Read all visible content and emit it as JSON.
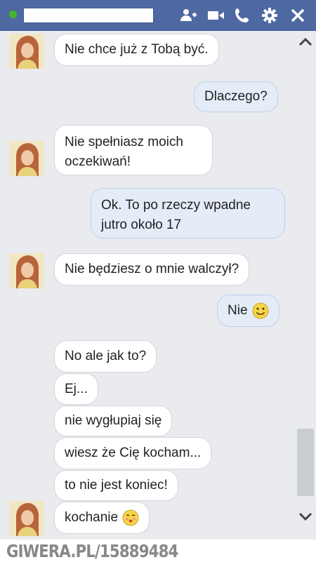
{
  "header": {
    "contact_name": "",
    "status": "online",
    "icons": [
      "add-friend-icon",
      "video-call-icon",
      "voice-call-icon",
      "settings-icon",
      "close-icon"
    ],
    "background_color": "#4e69a2"
  },
  "messages": [
    {
      "from": "them",
      "text": "Nie chce już z Tobą być."
    },
    {
      "from": "me",
      "text": "Dlaczego?"
    },
    {
      "from": "them",
      "text": "Nie spełniasz moich oczekiwań!"
    },
    {
      "from": "me",
      "text": "Ok. To po rzeczy wpadne jutro około 17"
    },
    {
      "from": "them",
      "text": "Nie będziesz o mnie walczył?"
    },
    {
      "from": "me",
      "text": "Nie",
      "emoji": "smile"
    },
    {
      "from": "them",
      "text": "No ale jak to?"
    },
    {
      "from": "them",
      "text": "Ej..."
    },
    {
      "from": "them",
      "text": "nie wygłupiaj się"
    },
    {
      "from": "them",
      "text": "wiesz że Cię kocham..."
    },
    {
      "from": "them",
      "text": "to nie jest koniec!"
    },
    {
      "from": "them",
      "text": "kochanie",
      "emoji": "kiss"
    }
  ],
  "watermark": {
    "text": "GIWERA.PL/15889484"
  }
}
